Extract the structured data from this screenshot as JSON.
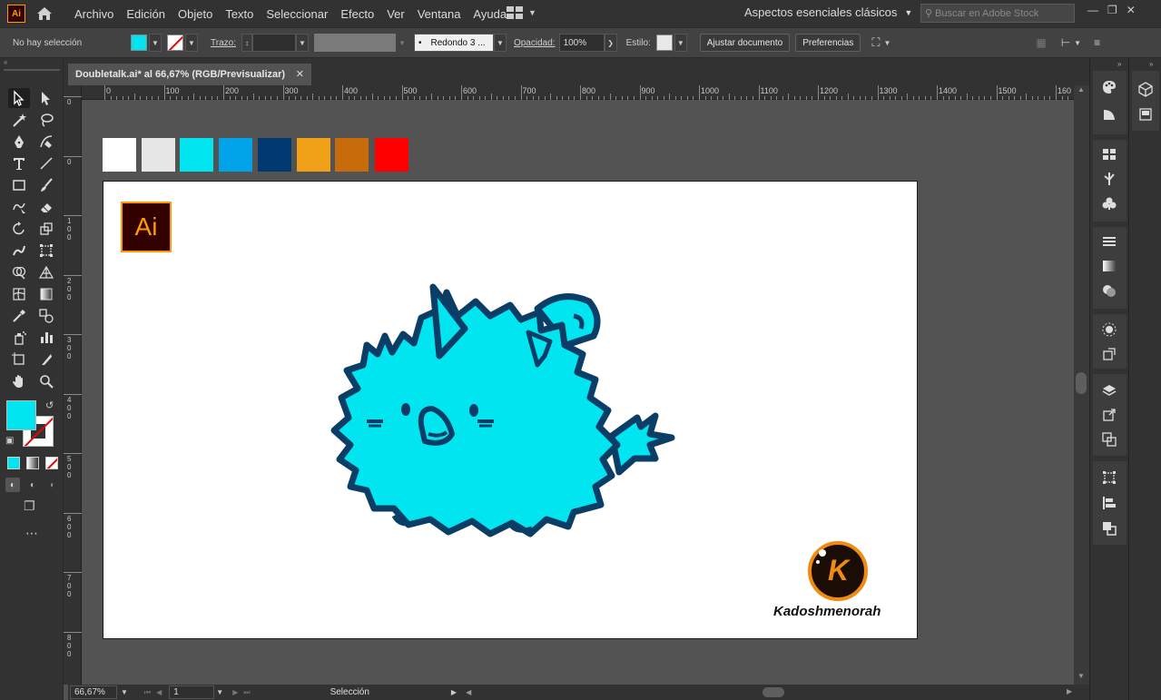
{
  "app": {
    "logo_text": "Ai"
  },
  "menu": [
    "Archivo",
    "Edición",
    "Objeto",
    "Texto",
    "Seleccionar",
    "Efecto",
    "Ver",
    "Ventana",
    "Ayuda"
  ],
  "workspace": {
    "label": "Aspectos esenciales clásicos"
  },
  "stock_search": {
    "placeholder": "Buscar en Adobe Stock"
  },
  "controlbar": {
    "selection_status": "No hay selección",
    "stroke_label": "Trazo:",
    "brush_label": "Redondo 3 ...",
    "opacity_label": "Opacidad:",
    "opacity_value": "100%",
    "style_label": "Estilo:",
    "fit_document_button": "Ajustar documento",
    "preferences_button": "Preferencias",
    "fill_color": "#00e5f0"
  },
  "document_tab": {
    "title": "Doubletalk.ai* al 66,67% (RGB/Previsualizar)"
  },
  "ruler": {
    "top_ticks": [
      "0",
      "100",
      "200",
      "300",
      "400",
      "500",
      "600",
      "700",
      "800",
      "900",
      "1000",
      "1100",
      "1200",
      "1300",
      "1400",
      "1500",
      "160"
    ],
    "left_ticks": [
      "0",
      "0",
      "1\n0\n0",
      "2\n0\n0",
      "3\n0\n0",
      "4\n0\n0",
      "5\n0\n0",
      "6\n0\n0",
      "7\n0\n0",
      "8\n0\n0"
    ]
  },
  "swatches": [
    "#ffffff",
    "#e6e6e6",
    "#00e5f0",
    "#00a3e8",
    "#003a70",
    "#f0a118",
    "#c86b0a",
    "#ff0000"
  ],
  "artboard": {
    "logo_text": "Ai",
    "brand_letter": "K",
    "brand_name": "Kadoshmenorah",
    "character_fill": "#00e5f0",
    "character_stroke": "#0b3e66"
  },
  "statusbar": {
    "zoom": "66,67%",
    "page": "1",
    "tool_status": "Selección"
  },
  "toolbar": {
    "fill": "#00e5f0",
    "stroke": "none"
  }
}
